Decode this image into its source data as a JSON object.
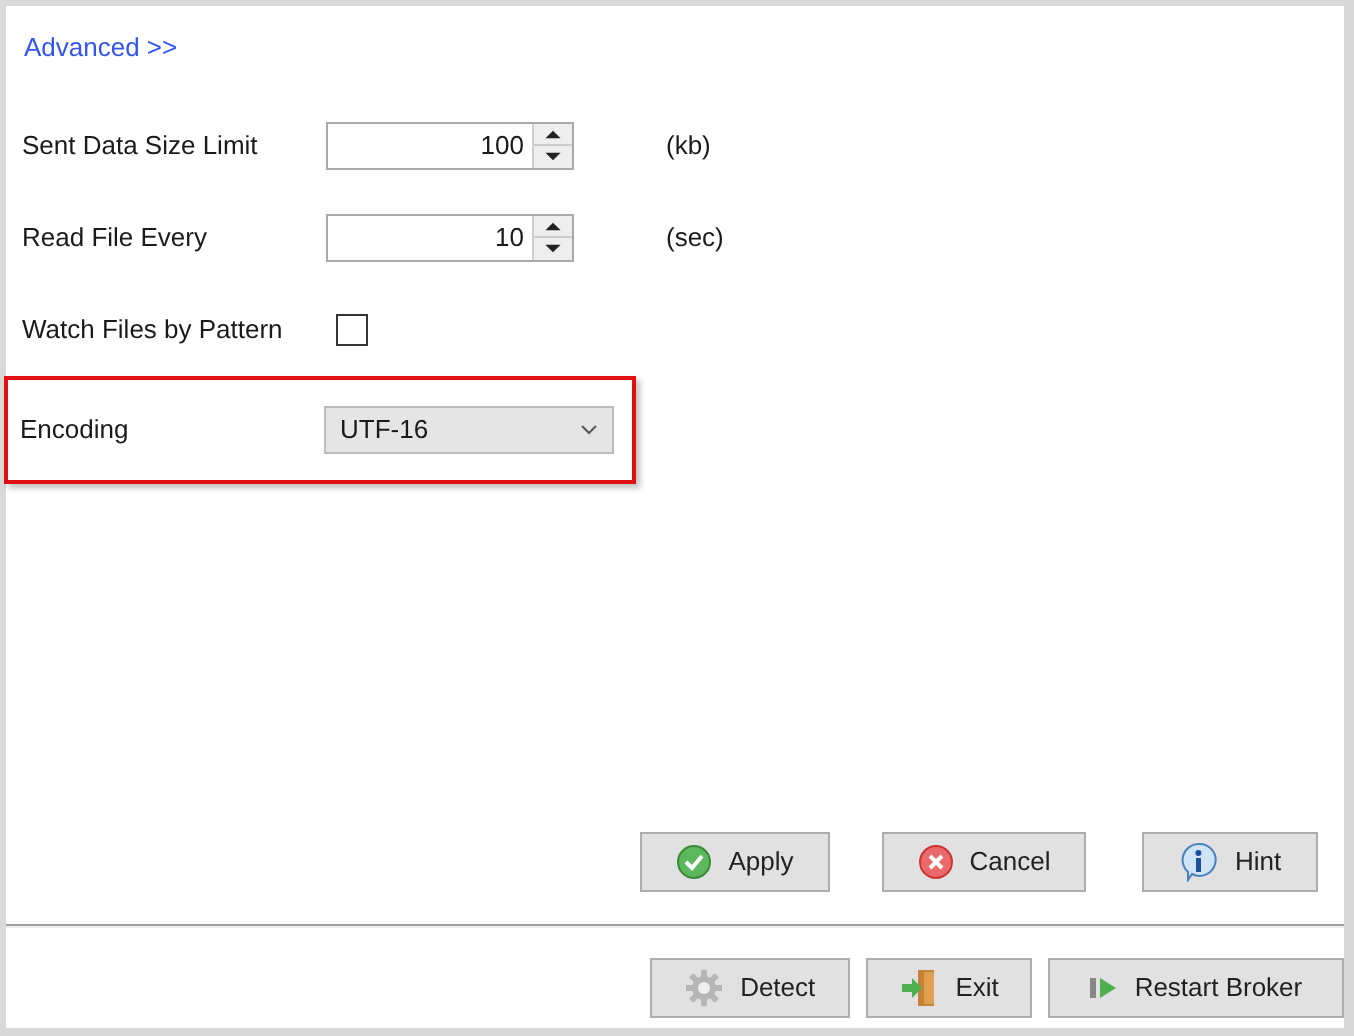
{
  "advanced_link": "Advanced >>",
  "fields": [
    {
      "kind": "spinner",
      "label": "Sent Data Size Limit",
      "value": "100",
      "unit": "(kb)",
      "highlighted": false
    },
    {
      "kind": "spinner",
      "label": "Read File Every",
      "value": "10",
      "unit": "(sec)",
      "highlighted": false
    },
    {
      "kind": "checkbox",
      "label": "Watch Files by Pattern",
      "checked": false,
      "highlighted": false
    },
    {
      "kind": "dropdown",
      "label": "Encoding",
      "value": "UTF-16",
      "highlighted": true
    }
  ],
  "form_buttons": [
    {
      "kind": "apply",
      "label": "Apply"
    },
    {
      "kind": "cancel",
      "label": "Cancel"
    },
    {
      "kind": "hint",
      "label": "Hint"
    }
  ],
  "footer_buttons": [
    {
      "kind": "detect",
      "label": "Detect"
    },
    {
      "kind": "exit",
      "label": "Exit"
    },
    {
      "kind": "restart",
      "label": "Restart Broker"
    }
  ]
}
